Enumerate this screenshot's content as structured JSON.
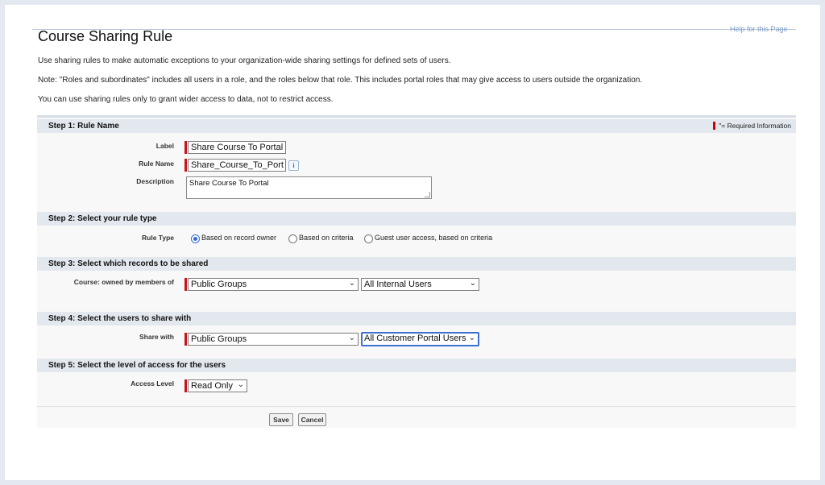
{
  "page": {
    "title": "Course Sharing Rule",
    "cut_link": "Help for this Page",
    "intro": [
      "Use sharing rules to make automatic exceptions to your organization-wide sharing settings for defined sets of users.",
      "Note: \"Roles and subordinates\" includes all users in a role, and the roles below that role. This includes portal roles that may give access to users outside the organization.",
      "You can use sharing rules only to grant wider access to data, not to restrict access."
    ]
  },
  "step1": {
    "title": "Step 1: Rule Name",
    "required_info": "= Required Information",
    "label_label": "Label",
    "label_value": "Share Course To Portal",
    "rule_name_label": "Rule Name",
    "rule_name_value": "Share_Course_To_Port",
    "description_label": "Description",
    "description_value": "Share Course To Portal"
  },
  "step2": {
    "title": "Step 2: Select your rule type",
    "rule_type_label": "Rule Type",
    "options": [
      "Based on record owner",
      "Based on criteria",
      "Guest user access, based on criteria"
    ],
    "selected_index": 0
  },
  "step3": {
    "title": "Step 3: Select which records to be shared",
    "owned_label": "Course: owned by members of",
    "group_type": "Public Groups",
    "group_value": "All Internal Users"
  },
  "step4": {
    "title": "Step 4: Select the users to share with",
    "share_with_label": "Share with",
    "group_type": "Public Groups",
    "group_value": "All Customer Portal Users"
  },
  "step5": {
    "title": "Step 5: Select the level of access for the users",
    "access_label": "Access Level",
    "access_value": "Read Only"
  },
  "buttons": {
    "save": "Save",
    "cancel": "Cancel"
  },
  "icons": {
    "info": "info-icon",
    "dropdown": "chevron-down-icon"
  },
  "colors": {
    "required": "#c4161c",
    "section_header": "#e3e8ef",
    "focus": "#3d6fce",
    "background": "#e3e8f1"
  }
}
